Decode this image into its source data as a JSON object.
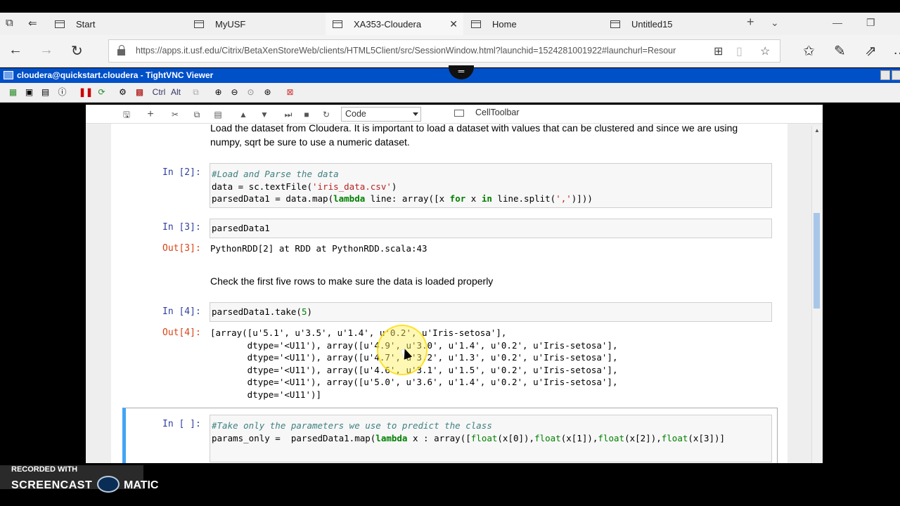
{
  "browser": {
    "tabs": [
      {
        "label": "Start"
      },
      {
        "label": "MyUSF"
      },
      {
        "label": "XA353-Cloudera"
      },
      {
        "label": "Home"
      },
      {
        "label": "Untitled15"
      }
    ],
    "url": "https://apps.it.usf.edu/Citrix/BetaXenStoreWeb/clients/HTML5Client/src/SessionWindow.html?launchid=1524281001922#launchurl=Resour"
  },
  "vnc": {
    "title": "cloudera@quickstart.cloudera - TightVNC Viewer",
    "toolbar": {
      "ctrl": "Ctrl",
      "alt": "Alt"
    }
  },
  "notebook": {
    "toolbar": {
      "cell_type": "Code",
      "cell_toolbar": "CellToolbar"
    },
    "md1": [
      "Load the dataset from Cloudera. It is important to load a dataset with values that can be clustered and since we are using",
      "numpy, sqrt be sure to use a numeric dataset."
    ],
    "cells": {
      "c2": {
        "prompt": "In [2]:",
        "l1": "#Load and Parse the data",
        "l2a": "data = sc.textFile(",
        "l2b": "'iris_data.csv'",
        "l2c": ")",
        "l3a": "parsedData1 = data.map(",
        "l3b": "lambda",
        "l3c": " line: array([x ",
        "l3d": "for",
        "l3e": " x ",
        "l3f": "in",
        "l3g": " line.split(",
        "l3h": "','",
        "l3i": ")]))"
      },
      "c3": {
        "prompt": "In [3]:",
        "code": "parsedData1",
        "out_prompt": "Out[3]:",
        "output": "PythonRDD[2] at RDD at PythonRDD.scala:43"
      },
      "md2": "Check the first five rows to make sure the data is loaded properly",
      "c4": {
        "prompt": "In [4]:",
        "code_a": "parsedData1.take(",
        "code_b": "5",
        "code_c": ")",
        "out_prompt": "Out[4]:",
        "output": [
          "[array([u'5.1', u'3.5', u'1.4', u'0.2', u'Iris-setosa'],",
          "       dtype='<U11'), array([u'4.9', u'3.0', u'1.4', u'0.2', u'Iris-setosa'],",
          "       dtype='<U11'), array([u'4.7', u'3.2', u'1.3', u'0.2', u'Iris-setosa'],",
          "       dtype='<U11'), array([u'4.6', u'3.1', u'1.5', u'0.2', u'Iris-setosa'],",
          "       dtype='<U11'), array([u'5.0', u'3.6', u'1.4', u'0.2', u'Iris-setosa'],",
          "       dtype='<U11')]"
        ]
      },
      "c5": {
        "prompt": "In [ ]:",
        "l1": "#Take only the parameters we use to predict the class",
        "l2a": "params_only =  parsedData1.map(",
        "l2b": "lambda",
        "l2c": " x : array([",
        "l2d": "float",
        "l2e": "(x[0]),",
        "l2f": "float",
        "l2g": "(x[1]),",
        "l2h": "float",
        "l2i": "(x[2]),",
        "l2j": "float",
        "l2k": "(x[3])]"
      }
    }
  },
  "watermark": {
    "line1": "RECORDED WITH",
    "line2a": "SCREENCAST",
    "line2b": "MATIC"
  }
}
